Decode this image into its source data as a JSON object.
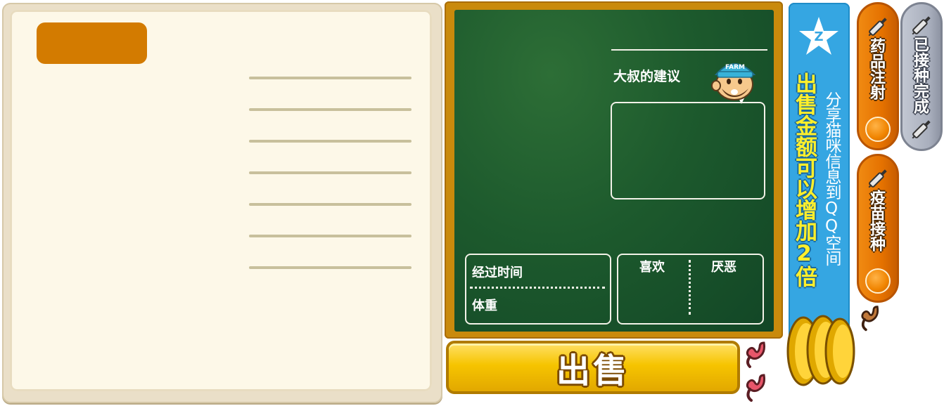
{
  "advice_board": {
    "title": "大叔的建议",
    "cap_text": "FARM",
    "elapsed_label": "经过时间",
    "weight_label": "体重",
    "likes_label": "喜欢",
    "dislikes_label": "厌恶"
  },
  "sell_button": {
    "label": "出售"
  },
  "share_banner": {
    "line1": "分享猫咪信息到QQ空间",
    "line2": "出售金额可以增加2倍"
  },
  "side_buttons": {
    "medicine_injection": "药品注射",
    "vaccination": "疫苗接种",
    "vaccinated_done": "已接种完成"
  },
  "colors": {
    "board_green": "#1d5a2d",
    "frame_wood": "#c98a0c",
    "sell_yellow": "#f6c400",
    "banner_blue": "#35a6e2",
    "button_orange": "#e57200",
    "button_grey": "#a9afbd"
  },
  "icons": [
    "syringe-icon",
    "stomach-icon",
    "gold-coins-icon",
    "qzone-star-icon",
    "farmer-avatar-icon"
  ]
}
